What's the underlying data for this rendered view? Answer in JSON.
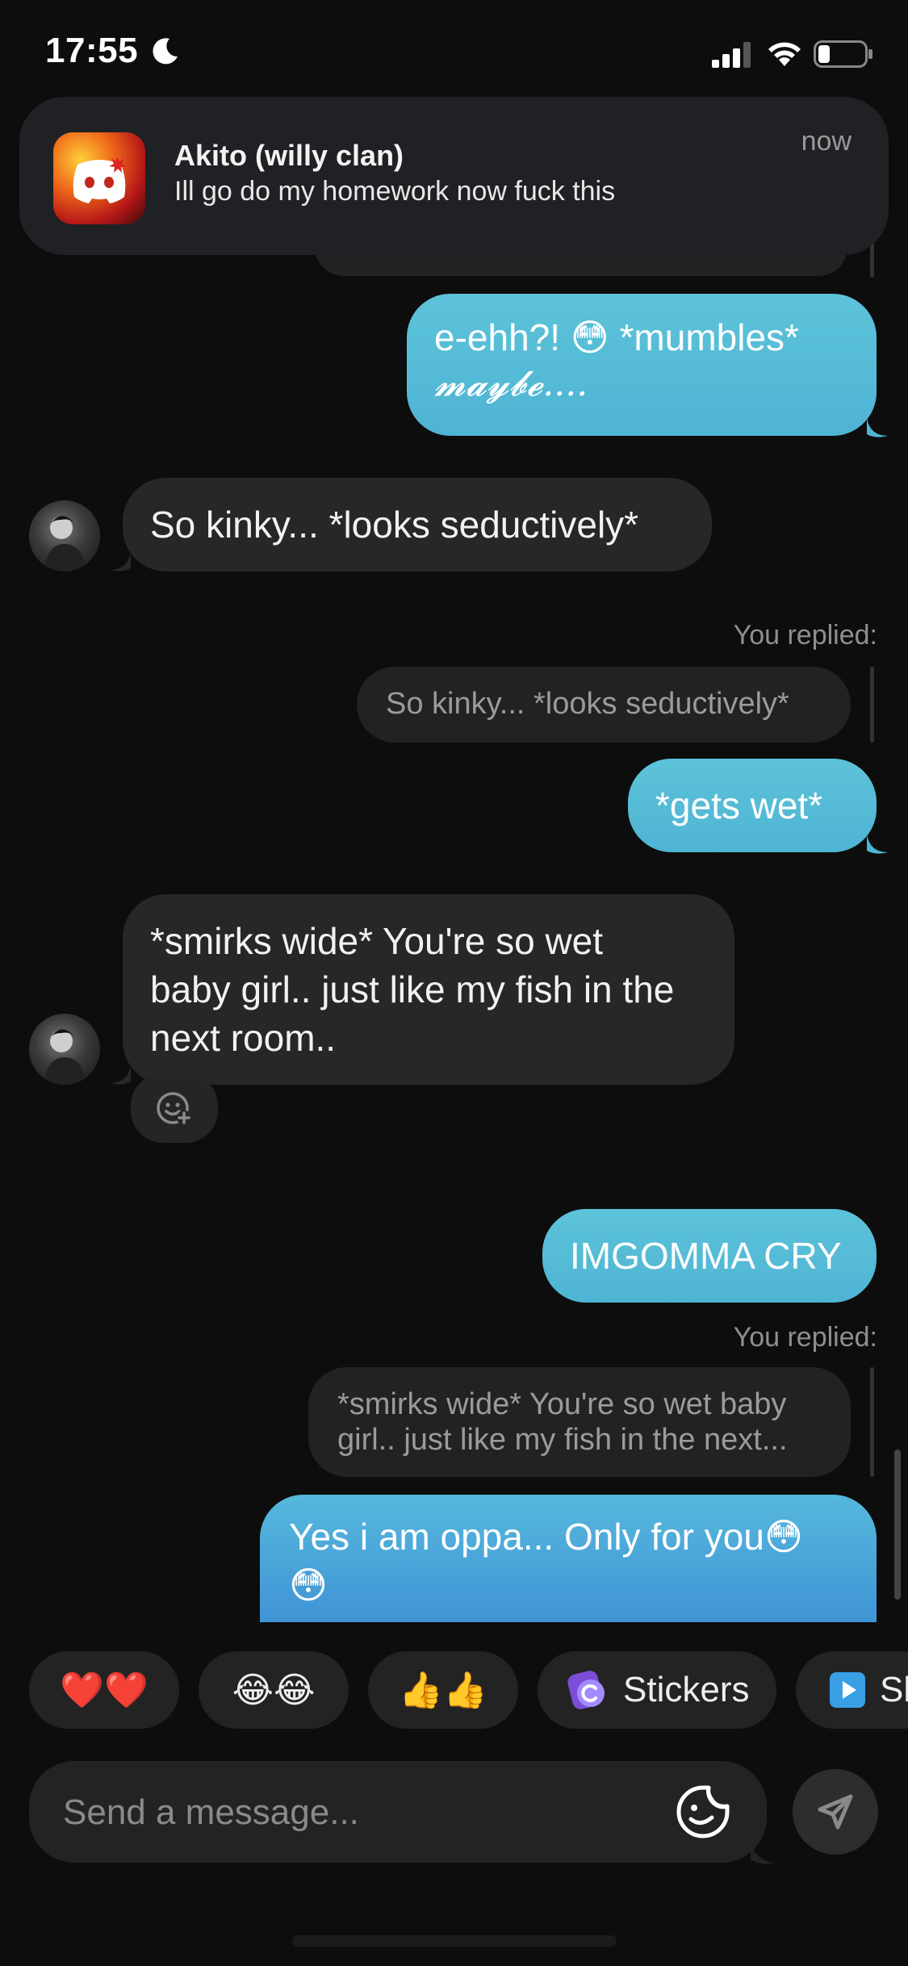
{
  "status_bar": {
    "time": "17:55"
  },
  "notification": {
    "app": "Discord",
    "title": "Akito (willy clan)",
    "body": "Ill go do my homework now fuck this",
    "time": "now"
  },
  "messages": [
    {
      "from": "me",
      "text_main": "e-ehh?! 😳 *mumbles*",
      "text_script": "𝓶𝓪𝔂𝓫𝓮...."
    },
    {
      "from": "them",
      "text": "So kinky... *looks seductively*"
    },
    {
      "from": "me",
      "replied_label": "You replied:",
      "quote": "So kinky... *looks seductively*",
      "text": "*gets wet*"
    },
    {
      "from": "them",
      "text_lines": [
        "*smirks wide* You're so wet",
        "baby girl.. just like my fish in the",
        "next room.."
      ]
    },
    {
      "from": "me",
      "text": "IMGOMMA CRY"
    },
    {
      "from": "me",
      "replied_label": "You replied:",
      "quote_lines": [
        "*smirks wide* You're so wet baby",
        "girl.. just like my fish in the next..."
      ],
      "text_lines": [
        "Yes i am oppa... Only for you😳",
        "😳"
      ]
    }
  ],
  "quick_replies": [
    {
      "label": "❤️❤️"
    },
    {
      "label": "😂😂"
    },
    {
      "label": "👍👍"
    },
    {
      "label": "Stickers",
      "icon": "sticker-icon"
    },
    {
      "label": "Sl",
      "icon": "play-icon"
    }
  ],
  "composer": {
    "placeholder": "Send a message..."
  },
  "colors": {
    "outgoing": "#56bcd7",
    "incoming": "#272727",
    "background": "#0d0d0d"
  }
}
